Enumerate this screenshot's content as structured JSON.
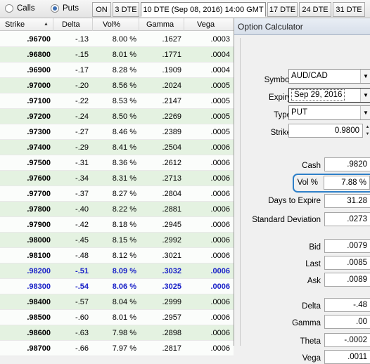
{
  "option_type": {
    "calls_label": "Calls",
    "puts_label": "Puts",
    "selected": "Puts"
  },
  "dte_tabs": [
    "ON",
    "3 DTE",
    "10 DTE (Sep 08, 2016) 14:00 GMT",
    "17 DTE",
    "24 DTE",
    "31 DTE"
  ],
  "active_tab": "10 DTE (Sep 08, 2016) 14:00 GMT",
  "table": {
    "columns": [
      "Strike",
      "Delta",
      "Vol%",
      "Gamma",
      "Vega"
    ],
    "sort_icon": "sort-up-icon",
    "rows": [
      [
        ".96700",
        "-.13",
        "8.00 %",
        ".1627",
        ".0003"
      ],
      [
        ".96800",
        "-.15",
        "8.01 %",
        ".1771",
        ".0004"
      ],
      [
        ".96900",
        "-.17",
        "8.28 %",
        ".1909",
        ".0004"
      ],
      [
        ".97000",
        "-.20",
        "8.56 %",
        ".2024",
        ".0005"
      ],
      [
        ".97100",
        "-.22",
        "8.53 %",
        ".2147",
        ".0005"
      ],
      [
        ".97200",
        "-.24",
        "8.50 %",
        ".2269",
        ".0005"
      ],
      [
        ".97300",
        "-.27",
        "8.46 %",
        ".2389",
        ".0005"
      ],
      [
        ".97400",
        "-.29",
        "8.41 %",
        ".2504",
        ".0006"
      ],
      [
        ".97500",
        "-.31",
        "8.36 %",
        ".2612",
        ".0006"
      ],
      [
        ".97600",
        "-.34",
        "8.31 %",
        ".2713",
        ".0006"
      ],
      [
        ".97700",
        "-.37",
        "8.27 %",
        ".2804",
        ".0006"
      ],
      [
        ".97800",
        "-.40",
        "8.22 %",
        ".2881",
        ".0006"
      ],
      [
        ".97900",
        "-.42",
        "8.18 %",
        ".2945",
        ".0006"
      ],
      [
        ".98000",
        "-.45",
        "8.15 %",
        ".2992",
        ".0006"
      ],
      [
        ".98100",
        "-.48",
        "8.12 %",
        ".3021",
        ".0006"
      ],
      [
        ".98200",
        "-.51",
        "8.09 %",
        ".3032",
        ".0006"
      ],
      [
        ".98300",
        "-.54",
        "8.06 %",
        ".3025",
        ".0006"
      ],
      [
        ".98400",
        "-.57",
        "8.04 %",
        ".2999",
        ".0006"
      ],
      [
        ".98500",
        "-.60",
        "8.01 %",
        ".2957",
        ".0006"
      ],
      [
        ".98600",
        "-.63",
        "7.98 %",
        ".2898",
        ".0006"
      ],
      [
        ".98700",
        "-.66",
        "7.97 %",
        ".2817",
        ".0006"
      ]
    ],
    "highlighted_strikes": [
      ".98200",
      ".98300"
    ]
  },
  "calculator": {
    "title": "Option Calculator",
    "symbol_label": "Symbol",
    "symbol_value": "AUD/CAD",
    "expiry_label": "Expiry",
    "expiry_value": "Sep 29, 2016",
    "type_label": "Type",
    "type_value": "PUT",
    "strike_label": "Strike",
    "strike_value": "0.9800",
    "cash_label": "Cash",
    "cash_value": ".9820",
    "vol_label": "Vol %",
    "vol_value": "7.88 %",
    "days_label": "Days to Expire",
    "days_value": "31.28",
    "stddev_label": "Standard Deviation",
    "stddev_value": ".0273",
    "bid_label": "Bid",
    "bid_value": ".0079",
    "last_label": "Last",
    "last_value": ".0085",
    "ask_label": "Ask",
    "ask_value": ".0089",
    "delta_label": "Delta",
    "delta_value": "-.48",
    "gamma_label": "Gamma",
    "gamma_value": ".00",
    "theta_label": "Theta",
    "theta_value": "-.0002",
    "vega_label": "Vega",
    "vega_value": ".0011"
  },
  "colors": {
    "row_alt": "#e4f2e1",
    "highlight_text": "#1a22c8",
    "vol_ring": "#2f80c8"
  }
}
